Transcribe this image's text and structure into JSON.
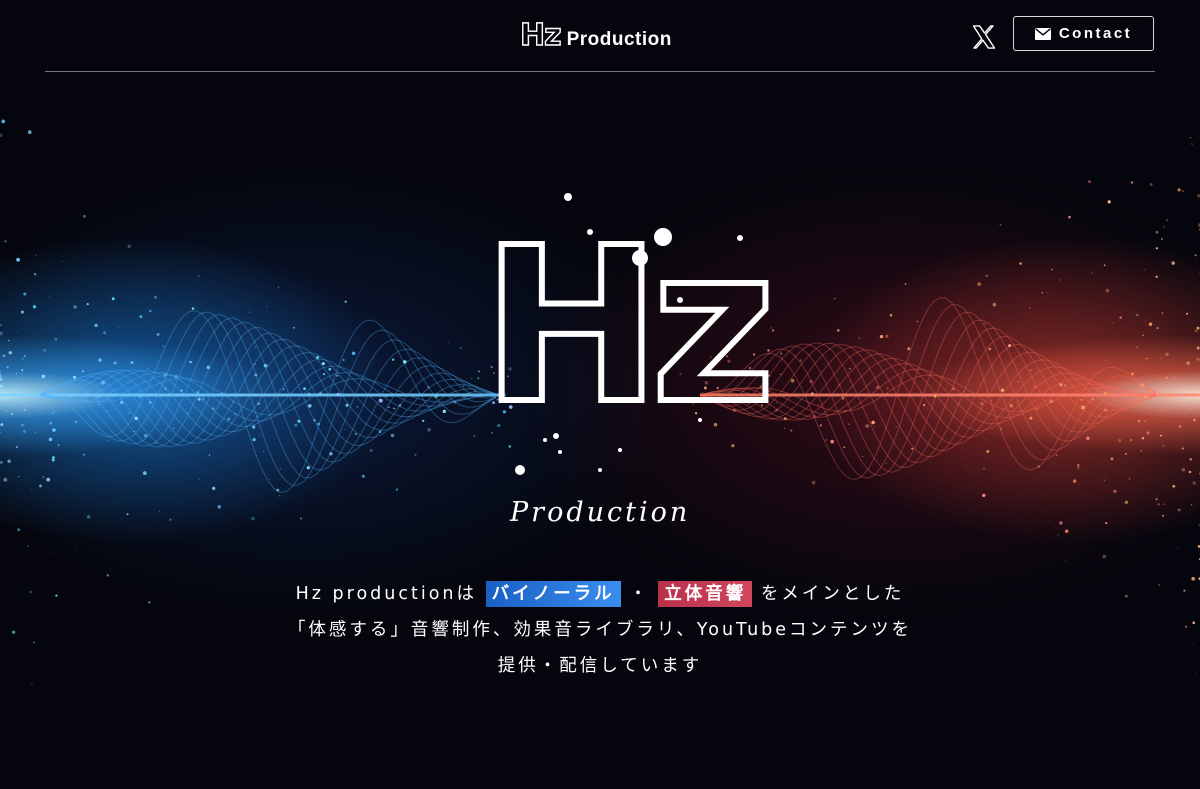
{
  "header": {
    "brand_logo_text": "Hz",
    "brand_text": "Production",
    "contact_label": "Contact"
  },
  "hero": {
    "logo_text": "Hz",
    "logo_subtitle": "Production",
    "tagline": {
      "line1_prefix": "Hz productionは",
      "highlight1": "バイノーラル",
      "separator": "・",
      "highlight2": "立体音響",
      "line1_suffix": "をメインとした",
      "line2": "「体感する」音響制作、効果音ライブラリ、YouTubeコンテンツを",
      "line3": "提供・配信しています"
    }
  },
  "colors": {
    "background": "#05060d",
    "accent_blue": "#2a7ee0",
    "accent_red": "#c83c54"
  },
  "icons": {
    "x": "x-logo-icon",
    "mail": "mail-icon"
  }
}
